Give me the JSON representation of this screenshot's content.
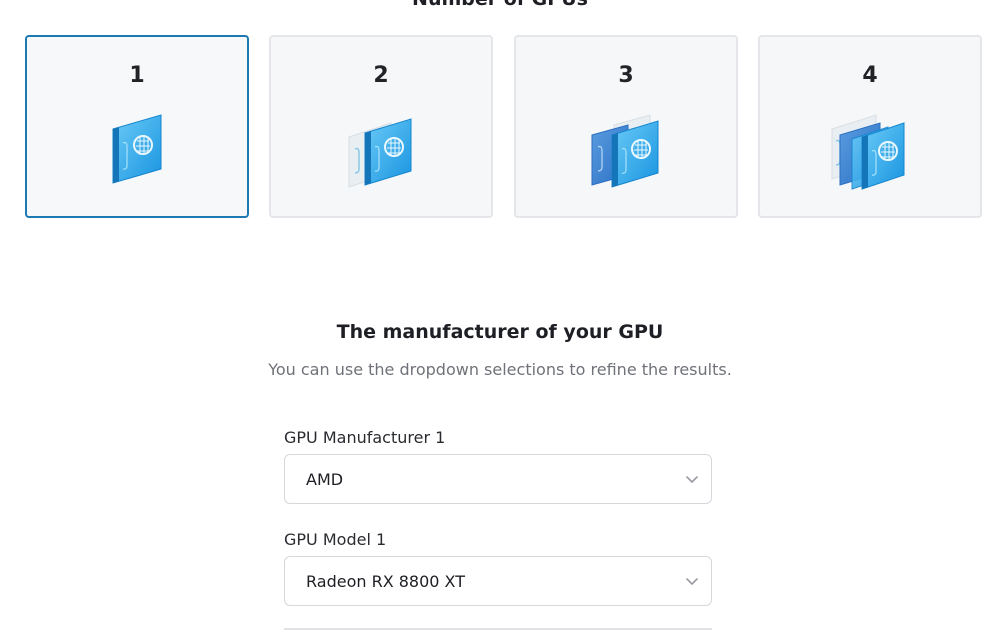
{
  "gpu_count_section": {
    "title": "Number of GPUs",
    "options": [
      {
        "label": "1",
        "selected": true,
        "icon": "gpu-card-icon"
      },
      {
        "label": "2",
        "selected": false,
        "icon": "gpu-card-icon"
      },
      {
        "label": "3",
        "selected": false,
        "icon": "gpu-card-icon"
      },
      {
        "label": "4",
        "selected": false,
        "icon": "gpu-card-icon"
      }
    ]
  },
  "manufacturer_section": {
    "title": "The manufacturer of your GPU",
    "subtitle": "You can use the dropdown selections to refine the results.",
    "fields": [
      {
        "label": "GPU Manufacturer 1",
        "value": "AMD"
      },
      {
        "label": "GPU Model 1",
        "value": "Radeon RX 8800 XT"
      }
    ]
  },
  "colors": {
    "selected_border": "#1d79b2",
    "card_border": "#e4e6ea",
    "card_background": "#f6f7f8",
    "gpu_blue": "#1f9fe8",
    "gpu_light": "#64c8f6",
    "muted_text": "#6f7278"
  }
}
